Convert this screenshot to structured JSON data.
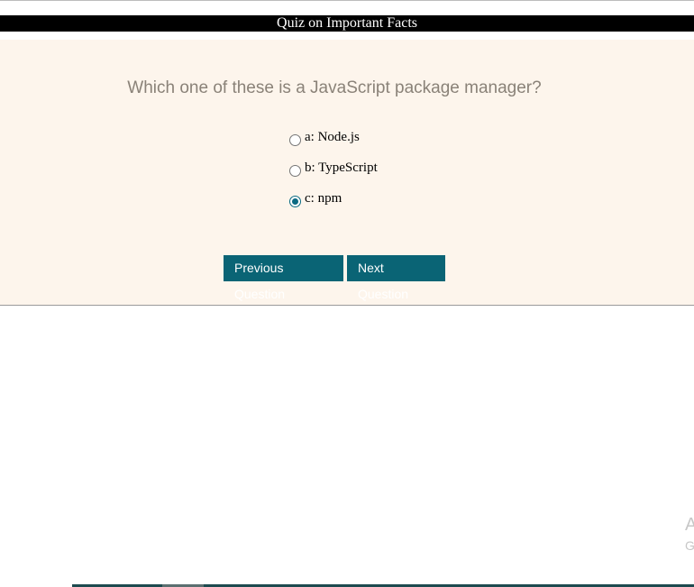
{
  "header": {
    "title": "Quiz on Important Facts"
  },
  "quiz": {
    "question": "Which one of these is a JavaScript package manager?",
    "options": [
      {
        "label": "a: Node.js",
        "checked": false
      },
      {
        "label": "b: TypeScript",
        "checked": false
      },
      {
        "label": "c: npm",
        "checked": true
      }
    ],
    "buttons": {
      "previous": "Previous Question",
      "next": "Next Question"
    }
  },
  "watermark": {
    "line1": "A",
    "line2": "G"
  },
  "colors": {
    "title_bar": "#000000",
    "panel_bg": "#fdf5ec",
    "button_bg": "#0a6475",
    "radio_accent": "#0b6a82",
    "question_text": "#8a8278"
  }
}
